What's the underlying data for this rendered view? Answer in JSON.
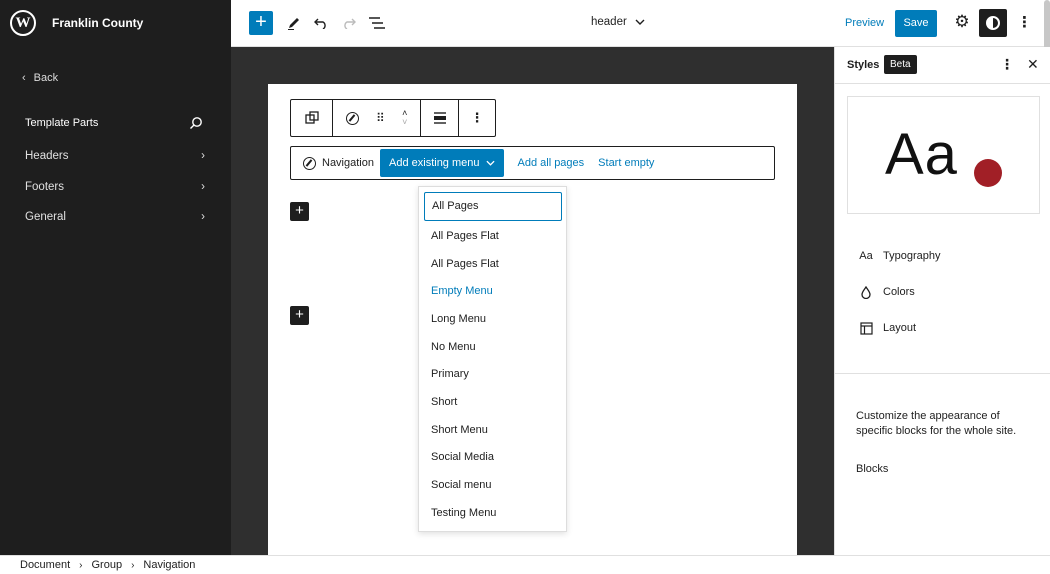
{
  "sidebar": {
    "site_name": "Franklin County",
    "back_label": "Back",
    "section_title": "Template Parts",
    "items": [
      {
        "label": "Headers"
      },
      {
        "label": "Footers"
      },
      {
        "label": "General"
      }
    ]
  },
  "topbar": {
    "document_title": "header",
    "preview_label": "Preview",
    "save_label": "Save"
  },
  "navigation_block": {
    "label": "Navigation",
    "add_existing_label": "Add existing menu",
    "add_all_pages_label": "Add all pages",
    "start_empty_label": "Start empty"
  },
  "menu_dropdown": {
    "items": [
      "All Pages",
      "All Pages Flat",
      "All Pages Flat",
      "Empty Menu",
      "Long Menu",
      "No Menu",
      "Primary",
      "Short",
      "Short Menu",
      "Social Media",
      "Social menu",
      "Testing Menu"
    ]
  },
  "styles_panel": {
    "title": "Styles",
    "badge": "Beta",
    "preview_text": "Aa",
    "preview_dot_color": "#a11f26",
    "rows": [
      {
        "label": "Typography",
        "icon_glyph": "Aa"
      },
      {
        "label": "Colors"
      },
      {
        "label": "Layout"
      }
    ],
    "description": "Customize the appearance of specific blocks for the whole site.",
    "blocks_label": "Blocks"
  },
  "breadcrumb": [
    "Document",
    "Group",
    "Navigation"
  ],
  "colors": {
    "accent": "#007cba",
    "dark": "#1e1e1e"
  }
}
